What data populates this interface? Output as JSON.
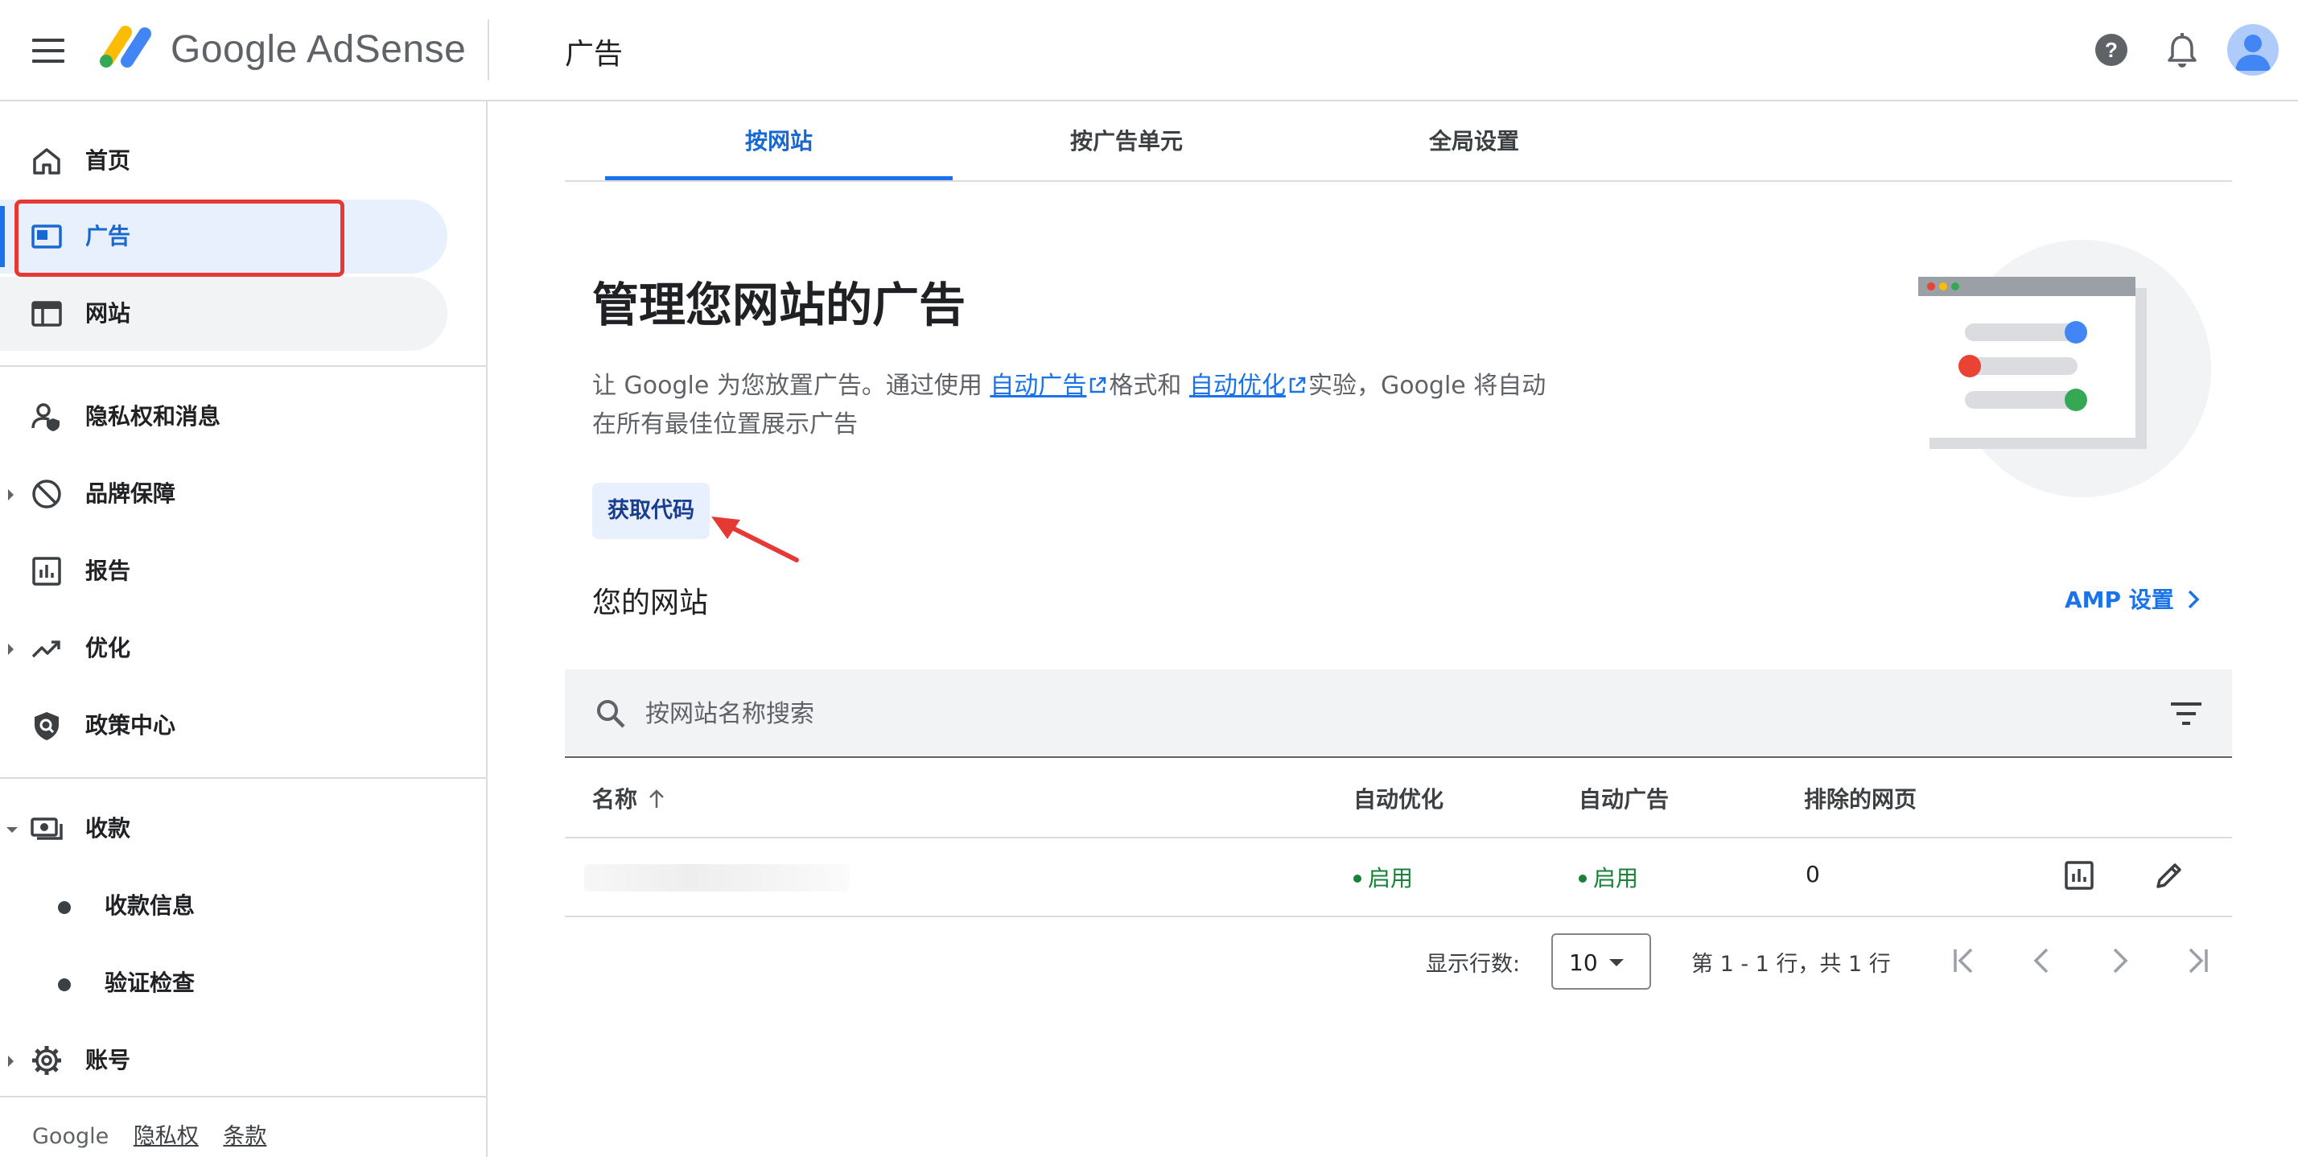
{
  "app": {
    "brand_google": "Google",
    "brand_product": "AdSense",
    "page_title": "广告"
  },
  "sidebar": {
    "items": [
      {
        "label": "首页",
        "icon": "home-icon"
      },
      {
        "label": "广告",
        "icon": "ads-icon",
        "active": true
      },
      {
        "label": "网站",
        "icon": "sites-icon"
      },
      {
        "label": "隐私权和消息",
        "icon": "privacy-icon"
      },
      {
        "label": "品牌保障",
        "icon": "block-icon"
      },
      {
        "label": "报告",
        "icon": "report-icon"
      },
      {
        "label": "优化",
        "icon": "trending-icon"
      },
      {
        "label": "政策中心",
        "icon": "policy-shield-icon"
      },
      {
        "label": "收款",
        "icon": "payments-icon"
      },
      {
        "label": "收款信息",
        "icon": "dot-icon"
      },
      {
        "label": "验证检查",
        "icon": "dot-icon"
      },
      {
        "label": "账号",
        "icon": "gear-icon"
      }
    ],
    "footer": {
      "google": "Google",
      "privacy": "隐私权",
      "terms": "条款"
    }
  },
  "tabs": [
    "按网站",
    "按广告单元",
    "全局设置"
  ],
  "hero": {
    "title": "管理您网站的广告",
    "desc_part1": "让 Google 为您放置广告。通过使用",
    "link_auto_ads": "自动广告",
    "desc_part2": "格式和",
    "link_auto_opt": "自动优化",
    "desc_part3": "实验，Google 将自动在所有最佳位置展示广告",
    "get_code": "获取代码"
  },
  "sites": {
    "heading": "您的网站",
    "amp_link": "AMP 设置",
    "search_placeholder": "按网站名称搜索",
    "columns": {
      "name": "名称",
      "auto_opt": "自动优化",
      "auto_ads": "自动广告",
      "excluded": "排除的网页"
    },
    "rows": [
      {
        "name": "",
        "auto_opt": "启用",
        "auto_ads": "启用",
        "excluded": "0"
      }
    ]
  },
  "pagination": {
    "rows_label": "显示行数:",
    "rows_value": "10",
    "range": "第 1 - 1 行，共 1 行"
  },
  "colors": {
    "accent": "#1a73e8",
    "active_bg": "#e8f0fe",
    "status_green": "#188038",
    "highlight_red": "#e53935"
  }
}
